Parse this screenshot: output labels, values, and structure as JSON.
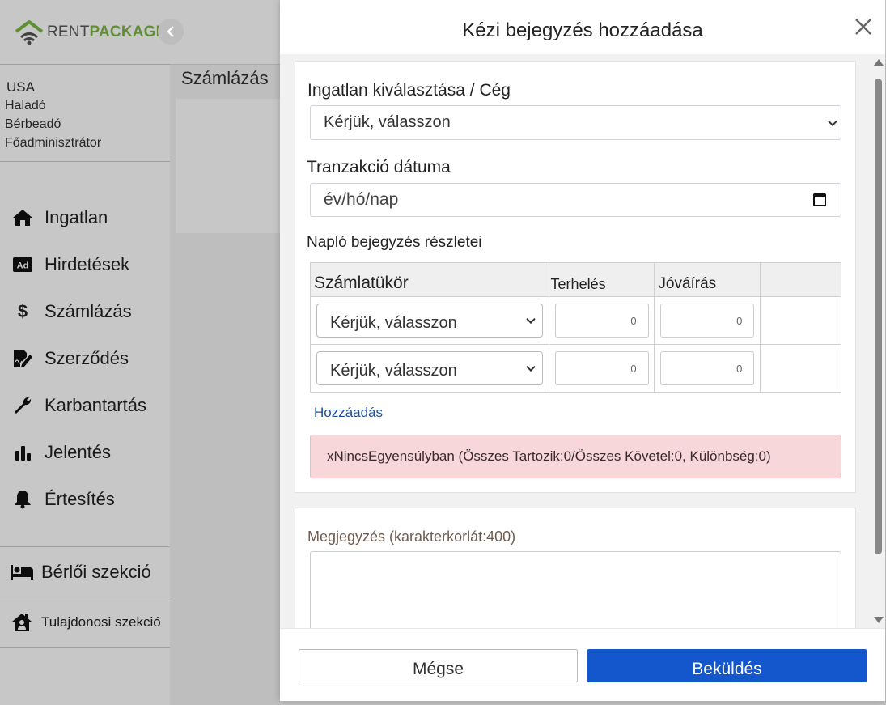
{
  "brand": {
    "part1": "RENT",
    "part2": "PACKAGE",
    "green": "#7bb842"
  },
  "user": {
    "country": "USA",
    "level": "Haladó",
    "role": "Bérbeadó",
    "admin": "Főadminisztrátor"
  },
  "nav": {
    "property": "Ingatlan",
    "ads": "Hirdetések",
    "billing": "Számlázás",
    "contract": "Szerződés",
    "maintenance": "Karbantartás",
    "report": "Jelentés",
    "notifications": "Értesítés"
  },
  "sections": {
    "tenant": "Bérlői szekció",
    "owner": "Tulajdonosi szekció"
  },
  "main": {
    "title": "Számlázás"
  },
  "modal": {
    "title": "Kézi bejegyzés hozzáadása",
    "property_label": "Ingatlan kiválasztása / Cég",
    "property_value": "Kérjük, válasszon",
    "date_label": "Tranzakció dátuma",
    "date_placeholder": "év/hó/nap",
    "journal_label": "Napló bejegyzés részletei",
    "table": {
      "headers": {
        "account": "Számlatükör",
        "debit": "Terhelés",
        "credit": "Jóváírás"
      },
      "rows": [
        {
          "account": "Kérjük, válasszon",
          "debit": "0",
          "credit": "0"
        },
        {
          "account": "Kérjük, válasszon",
          "debit": "0",
          "credit": "0"
        }
      ]
    },
    "add_link": "Hozzáadás",
    "alert": "xNincsEgyensúlyban (Összes Tartozik:0/Összes Követel:0, Különbség:0)",
    "note_label": "Megjegyzés (karakterkorlát:400)",
    "cancel": "Mégse",
    "submit": "Beküldés",
    "submit_color": "#1456cc",
    "alert_color": "#f8d7da"
  }
}
